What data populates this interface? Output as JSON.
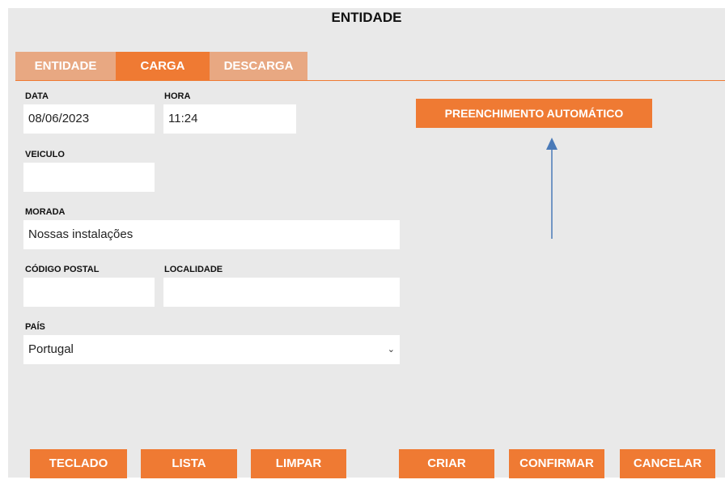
{
  "title": "ENTIDADE",
  "tabs": [
    {
      "label": "ENTIDADE",
      "active": false
    },
    {
      "label": "CARGA",
      "active": true
    },
    {
      "label": "DESCARGA",
      "active": false
    }
  ],
  "form": {
    "data": {
      "label": "DATA",
      "value": "08/06/2023"
    },
    "hora": {
      "label": "HORA",
      "value": "11:24"
    },
    "veiculo": {
      "label": "VEICULO",
      "value": ""
    },
    "morada": {
      "label": "MORADA",
      "value": "Nossas instalações"
    },
    "codigo_postal": {
      "label": "CÓDIGO POSTAL",
      "value": ""
    },
    "localidade": {
      "label": "LOCALIDADE",
      "value": ""
    },
    "pais": {
      "label": "PAÍS",
      "value": "Portugal"
    }
  },
  "auto_fill_label": "PREENCHIMENTO AUTOMÁTICO",
  "buttons": {
    "teclado": "TECLADO",
    "lista": "LISTA",
    "limpar": "LIMPAR",
    "criar": "CRIAR",
    "confirmar": "CONFIRMAR",
    "cancelar": "CANCELAR"
  },
  "colors": {
    "accent": "#ef7a33",
    "tab_inactive": "#e8a882",
    "panel_bg": "#e9e9e9",
    "annotation_arrow": "#4a7ab8"
  },
  "icons": {
    "select_arrow": "chevron-down-icon",
    "annotation": "arrow-up-icon"
  }
}
